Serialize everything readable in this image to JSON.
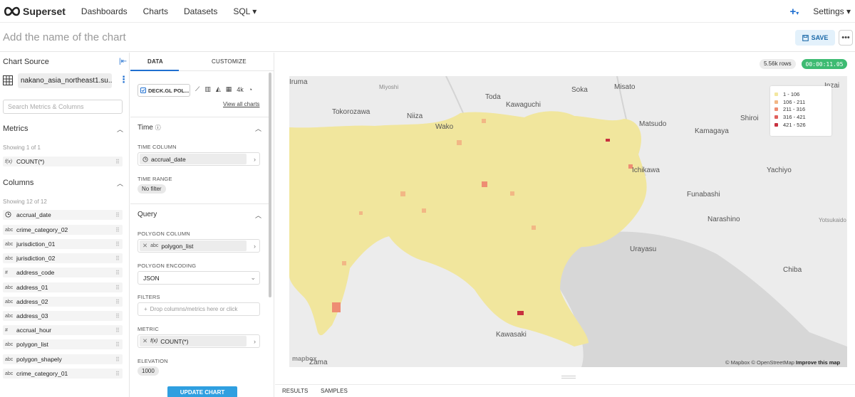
{
  "nav": {
    "brand": "Superset",
    "items": [
      "Dashboards",
      "Charts",
      "Datasets",
      "SQL ▾"
    ],
    "settings": "Settings ▾"
  },
  "header": {
    "chart_name_placeholder": "Add the name of the chart",
    "save_label": "SAVE"
  },
  "left": {
    "chart_source_title": "Chart Source",
    "dataset_name": "nakano_asia_northeast1.su...",
    "search_placeholder": "Search Metrics & Columns",
    "metrics_title": "Metrics",
    "metrics_showing": "Showing 1 of 1",
    "metrics": [
      {
        "type": "f(x)",
        "name": "COUNT(*)"
      }
    ],
    "columns_title": "Columns",
    "columns_showing": "Showing 12 of 12",
    "columns": [
      {
        "type": "clock",
        "name": "accrual_date"
      },
      {
        "type": "abc",
        "name": "crime_category_02"
      },
      {
        "type": "abc",
        "name": "jurisdiction_01"
      },
      {
        "type": "abc",
        "name": "jurisdiction_02"
      },
      {
        "type": "#",
        "name": "address_code"
      },
      {
        "type": "abc",
        "name": "address_01"
      },
      {
        "type": "abc",
        "name": "address_02"
      },
      {
        "type": "abc",
        "name": "address_03"
      },
      {
        "type": "#",
        "name": "accrual_hour"
      },
      {
        "type": "abc",
        "name": "polygon_list"
      },
      {
        "type": "abc",
        "name": "polygon_shapely"
      },
      {
        "type": "abc",
        "name": "crime_category_01"
      }
    ]
  },
  "mid": {
    "tab_data": "DATA",
    "tab_customize": "CUSTOMIZE",
    "viz_type": "DECK.GL POL...",
    "viz_4k": "4k",
    "view_all": "View all charts",
    "time_section": "Time",
    "time_column_label": "TIME COLUMN",
    "time_column_value": "accrual_date",
    "time_range_label": "TIME RANGE",
    "time_range_value": "No filter",
    "query_section": "Query",
    "polygon_column_label": "POLYGON COLUMN",
    "polygon_column_type": "abc",
    "polygon_column_value": "polygon_list",
    "polygon_encoding_label": "POLYGON ENCODING",
    "polygon_encoding_value": "JSON",
    "filters_label": "FILTERS",
    "filters_placeholder": "Drop columns/metrics here or click",
    "metric_label": "METRIC",
    "metric_value": "COUNT(*)",
    "elevation_label": "ELEVATION",
    "elevation_value": "1000",
    "update_label": "UPDATE CHART"
  },
  "right": {
    "rows": "5.56k rows",
    "timer": "00:00:11.05",
    "legend": [
      {
        "label": "1 - 106",
        "color": "#f3e7a0"
      },
      {
        "label": "106 - 211",
        "color": "#f2b785"
      },
      {
        "label": "211 - 316",
        "color": "#ee8d73"
      },
      {
        "label": "316 - 421",
        "color": "#e0605c"
      },
      {
        "label": "421 - 526",
        "color": "#c8313f"
      }
    ],
    "cities": {
      "iruma": "Iruma",
      "miyoshi": "Miyoshi",
      "toda": "Toda",
      "soka": "Soka",
      "misato": "Misato",
      "tokorozawa": "Tokorozawa",
      "niiza": "Niiza",
      "kawaguchi": "Kawaguchi",
      "wako": "Wako",
      "matsudo": "Matsudo",
      "kamagaya": "Kamagaya",
      "shiroi": "Shiroi",
      "inzai": "Inzai",
      "ichikawa": "Ichikawa",
      "yachiyo": "Yachiyo",
      "funabashi": "Funabashi",
      "narashino": "Narashino",
      "urayasu": "Urayasu",
      "chiba": "Chiba",
      "kawasaki": "Kawasaki",
      "zama": "Zama",
      "yotsukaido": "Yotsukaido"
    },
    "attribution_copy": "© Mapbox © OpenStreetMap",
    "attribution_improve": "Improve this map",
    "mapbox_logo": "mapbox"
  },
  "bottom": {
    "results": "RESULTS",
    "samples": "SAMPLES"
  }
}
